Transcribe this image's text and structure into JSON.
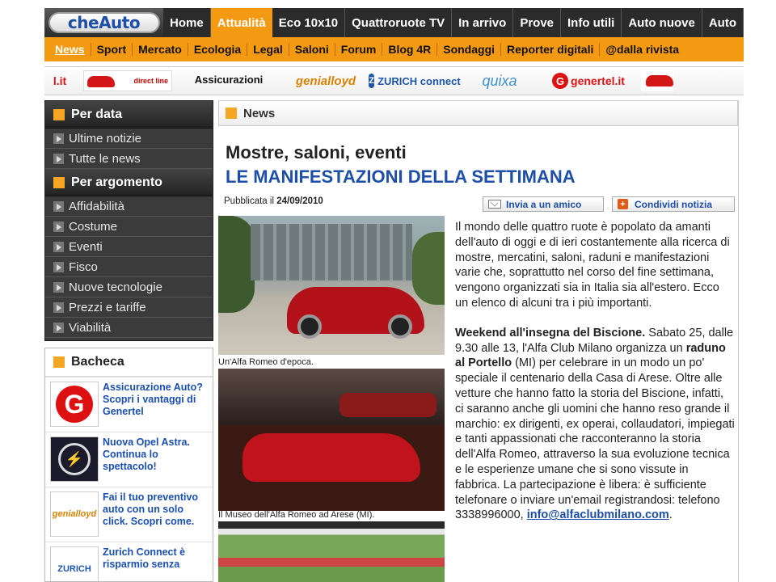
{
  "logo": "cheAuto",
  "top_nav": [
    {
      "label": "Home",
      "active": false
    },
    {
      "label": "Attualità",
      "active": true
    },
    {
      "label": "Eco 10x10",
      "active": false
    },
    {
      "label": "Quattroruote TV",
      "active": false
    },
    {
      "label": "In arrivo",
      "active": false
    },
    {
      "label": "Prove",
      "active": false
    },
    {
      "label": "Info utili",
      "active": false
    },
    {
      "label": "Auto nuove",
      "active": false
    },
    {
      "label": "Auto",
      "active": false
    }
  ],
  "sub_nav": [
    {
      "label": "News",
      "active": true
    },
    {
      "label": "Sport"
    },
    {
      "label": "Mercato"
    },
    {
      "label": "Ecologia"
    },
    {
      "label": "Legal"
    },
    {
      "label": "Saloni"
    },
    {
      "label": "Forum"
    },
    {
      "label": "Blog 4R"
    },
    {
      "label": "Sondaggi"
    },
    {
      "label": "Reporter digitali"
    },
    {
      "label": "@dalla rivista"
    }
  ],
  "sponsors": {
    "lit": "l.it",
    "direct_line": "direct line",
    "assicurazioni": "Assicurazioni",
    "genialloyd": "genialloyd",
    "zurich": "ZURICH connect",
    "quixa": "quixa",
    "genertel": "genertel.it"
  },
  "sidebar": {
    "per_data_title": "Per data",
    "per_data": [
      "Ultime notizie",
      "Tutte le news"
    ],
    "per_argomento_title": "Per argomento",
    "per_argomento": [
      "Affidabilità",
      "Costume",
      "Eventi",
      "Fisco",
      "Nuove tecnologie",
      "Prezzi e tariffe",
      "Viabilità"
    ]
  },
  "bacheca": {
    "title": "Bacheca",
    "ads": [
      {
        "text": "Assicurazione Auto? Scopri i vantaggi di Genertel",
        "brand": "G"
      },
      {
        "text": "Nuova Opel Astra. Continua lo spettacolo!",
        "brand": "opel"
      },
      {
        "text": "Fai il tuo preventivo auto con un solo click. Scopri come.",
        "brand": "genialloyd"
      },
      {
        "text": "Zurich Connect è risparmio senza",
        "brand": "ZURICH"
      }
    ]
  },
  "main": {
    "section_title": "News",
    "kicker": "Mostre, saloni, eventi",
    "headline": "LE MANIFESTAZIONI DELLA SETTIMANA",
    "published_label": "Pubblicata il",
    "published_date": "24/09/2010",
    "send_friend": "Invia a un amico",
    "share": "Condividi notizia",
    "caption1": "Un'Alfa Romeo d'epoca.",
    "caption2": "Il Museo dell'Alfa Romeo ad Arese (MI).",
    "para1": "Il mondo delle quattro ruote è popolato da amanti dell'auto di oggi e di ieri costantemente alla ricerca di mostre, mercatini, saloni, raduni e manifestazioni varie che, soprattutto nel corso del fine settimana, vengono organizzati sia in Italia sia all'estero. Ecco un elenco di alcuni tra i più importanti.",
    "para2_bold": "Weekend all'insegna del Biscione.",
    "para2_a": " Sabato 25, dalle 9.30 alle 13, l'Alfa Club Milano organizza un ",
    "para2_bold2": "raduno al Portello",
    "para2_b": " (MI) per celebrare in un modo un po' speciale il centenario della Casa di Arese. Oltre alle vetture che hanno fatto la storia del Biscione, infatti, ci saranno anche gli uomini che hanno reso grande il marchio: ex dirigenti, ex operai, collaudatori, impiegati e tanti appassionati che racconteranno la storia dell'Alfa Romeo, attraverso la sua evoluzione tecnica e le esperienze umane che si sono vissute in fabbrica. La partecipazione è libera: è sufficiente telefonare o inviare un'email registrandosi: telefono 3338996000,",
    "email": "info@alfaclubmilano.com",
    "para2_end": "."
  },
  "colors": {
    "accent": "#f39a12",
    "nav_dark": "#2b2b2b",
    "link": "#1d4ea8"
  }
}
